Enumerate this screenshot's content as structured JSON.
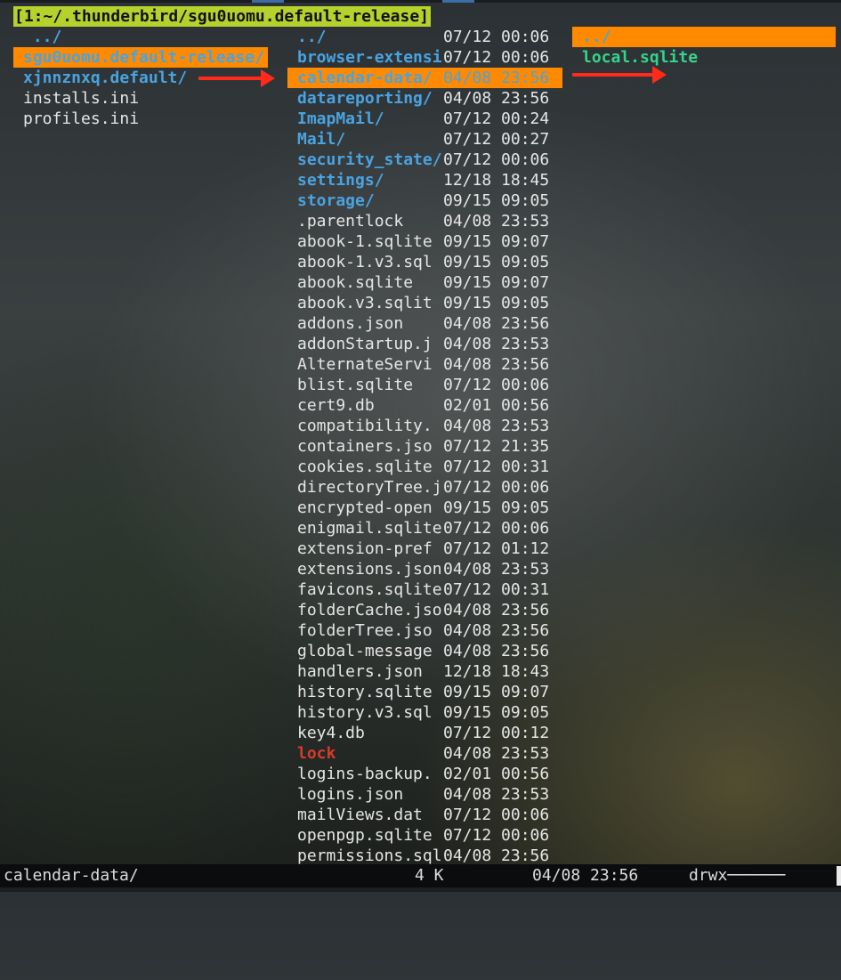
{
  "title": "[1:~/.thunderbird/sgu0uomu.default-release]",
  "parent_pane": {
    "items": [
      {
        "name": " ../",
        "kind": "updir"
      },
      {
        "name": "sgu0uomu.default-release/",
        "kind": "dir",
        "selected": true
      },
      {
        "name": "xjnnznxq.default/",
        "kind": "dir"
      },
      {
        "name": "installs.ini",
        "kind": "file"
      },
      {
        "name": "profiles.ini",
        "kind": "file"
      }
    ]
  },
  "current_pane": {
    "items": [
      {
        "name": "../",
        "kind": "updir",
        "date": "07/12 00:06"
      },
      {
        "name": "browser-extensi",
        "kind": "dir",
        "date": "07/12 00:06"
      },
      {
        "name": "calendar-data/",
        "kind": "dir",
        "date": "04/08 23:56",
        "selected": true
      },
      {
        "name": "datareporting/",
        "kind": "dir",
        "date": "04/08 23:56"
      },
      {
        "name": "ImapMail/",
        "kind": "dir",
        "date": "07/12 00:24"
      },
      {
        "name": "Mail/",
        "kind": "dir",
        "date": "07/12 00:27"
      },
      {
        "name": "security_state/",
        "kind": "dir",
        "date": "07/12 00:06"
      },
      {
        "name": "settings/",
        "kind": "dir",
        "date": "12/18 18:45"
      },
      {
        "name": "storage/",
        "kind": "dir",
        "date": "09/15 09:05"
      },
      {
        "name": ".parentlock",
        "kind": "file",
        "date": "04/08 23:53"
      },
      {
        "name": "abook-1.sqlite",
        "kind": "file",
        "date": "09/15 09:07"
      },
      {
        "name": "abook-1.v3.sql",
        "kind": "file",
        "date": "09/15 09:05"
      },
      {
        "name": "abook.sqlite",
        "kind": "file",
        "date": "09/15 09:07"
      },
      {
        "name": "abook.v3.sqlit",
        "kind": "file",
        "date": "09/15 09:05"
      },
      {
        "name": "addons.json",
        "kind": "file",
        "date": "04/08 23:56"
      },
      {
        "name": "addonStartup.j",
        "kind": "file",
        "date": "04/08 23:53"
      },
      {
        "name": "AlternateServi",
        "kind": "file",
        "date": "04/08 23:56"
      },
      {
        "name": "blist.sqlite",
        "kind": "file",
        "date": "07/12 00:06"
      },
      {
        "name": "cert9.db",
        "kind": "file",
        "date": "02/01 00:56"
      },
      {
        "name": "compatibility.",
        "kind": "file",
        "date": "04/08 23:53"
      },
      {
        "name": "containers.jso",
        "kind": "file",
        "date": "07/12 21:35"
      },
      {
        "name": "cookies.sqlite",
        "kind": "file",
        "date": "07/12 00:31"
      },
      {
        "name": "directoryTree.j",
        "kind": "file",
        "date": "07/12 00:06"
      },
      {
        "name": "encrypted-open",
        "kind": "file",
        "date": "09/15 09:05"
      },
      {
        "name": "enigmail.sqlite",
        "kind": "file",
        "date": "07/12 00:06"
      },
      {
        "name": "extension-pref",
        "kind": "file",
        "date": "07/12 01:12"
      },
      {
        "name": "extensions.json",
        "kind": "file",
        "date": "04/08 23:53"
      },
      {
        "name": "favicons.sqlite",
        "kind": "file",
        "date": "07/12 00:31"
      },
      {
        "name": "folderCache.jso",
        "kind": "file",
        "date": "04/08 23:56"
      },
      {
        "name": "folderTree.jso",
        "kind": "file",
        "date": "04/08 23:56"
      },
      {
        "name": "global-message",
        "kind": "file",
        "date": "04/08 23:56"
      },
      {
        "name": "handlers.json",
        "kind": "file",
        "date": "12/18 18:43"
      },
      {
        "name": "history.sqlite",
        "kind": "file",
        "date": "09/15 09:07"
      },
      {
        "name": "history.v3.sql",
        "kind": "file",
        "date": "09/15 09:05"
      },
      {
        "name": "key4.db",
        "kind": "file",
        "date": "07/12 00:12"
      },
      {
        "name": "lock",
        "kind": "link",
        "date": "04/08 23:53"
      },
      {
        "name": "logins-backup.",
        "kind": "file",
        "date": "02/01 00:56"
      },
      {
        "name": "logins.json",
        "kind": "file",
        "date": "04/08 23:53"
      },
      {
        "name": "mailViews.dat",
        "kind": "file",
        "date": "07/12 00:06"
      },
      {
        "name": "openpgp.sqlite",
        "kind": "file",
        "date": "07/12 00:06"
      },
      {
        "name": "permissions.sql",
        "kind": "file",
        "date": "04/08 23:56"
      }
    ]
  },
  "preview_pane": {
    "items": [
      {
        "name": "../",
        "kind": "updir",
        "selected": true
      },
      {
        "name": "local.sqlite",
        "kind": "green"
      }
    ]
  },
  "statusbar": {
    "name": "calendar-data/",
    "size": "4 K",
    "date": "04/08 23:56",
    "perms": "drwx──────"
  },
  "colors": {
    "title_bg": "#b7d12c",
    "selection_bg": "#ff8a00",
    "directory": "#4aa3e0",
    "link_red": "#d83a2a",
    "green_file": "#36d48a",
    "arrow": "#ff2a1a"
  }
}
